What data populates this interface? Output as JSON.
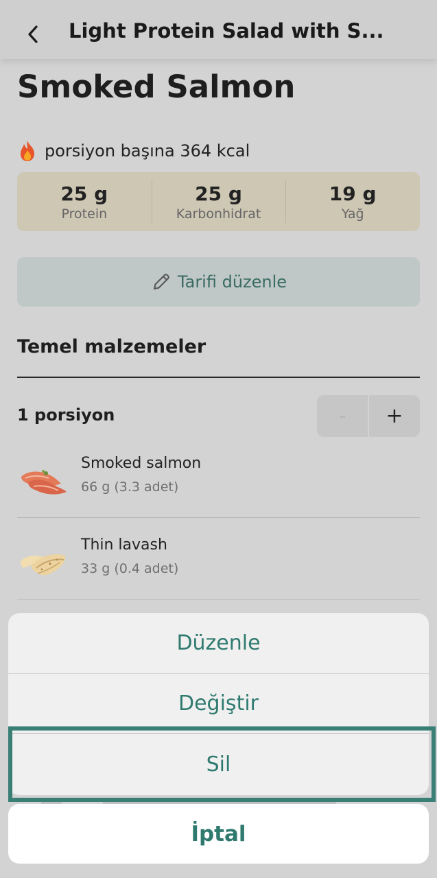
{
  "header": {
    "title": "Light Protein Salad with S..."
  },
  "recipe": {
    "title": "Smoked Salmon",
    "kcal_text": "porsiyon başına 364 kcal"
  },
  "macros": [
    {
      "value": "25 g",
      "label": "Protein"
    },
    {
      "value": "25 g",
      "label": "Karbonhidrat"
    },
    {
      "value": "19 g",
      "label": "Yağ"
    }
  ],
  "edit_recipe_label": "Tarifi düzenle",
  "ingredients_section": {
    "title": "Temel malzemeler",
    "portion_label": "1 porsiyon",
    "minus_label": "-",
    "plus_label": "+"
  },
  "ingredients": [
    {
      "name": "Smoked salmon",
      "amount": "66 g (3.3 adet)"
    },
    {
      "name": "Thin lavash",
      "amount": "33 g (0.4 adet)"
    }
  ],
  "action_sheet": {
    "items": [
      {
        "label": "Düzenle"
      },
      {
        "label": "Değiştir"
      },
      {
        "label": "Sil"
      }
    ],
    "cancel_label": "İptal"
  },
  "colors": {
    "accent": "#2f7a6f",
    "highlight_border": "#3a7f76",
    "macro_background": "#cdc7b4"
  },
  "icons": {
    "back": "chevron-left-icon",
    "kcal": "fire-icon",
    "edit": "pencil-icon"
  }
}
